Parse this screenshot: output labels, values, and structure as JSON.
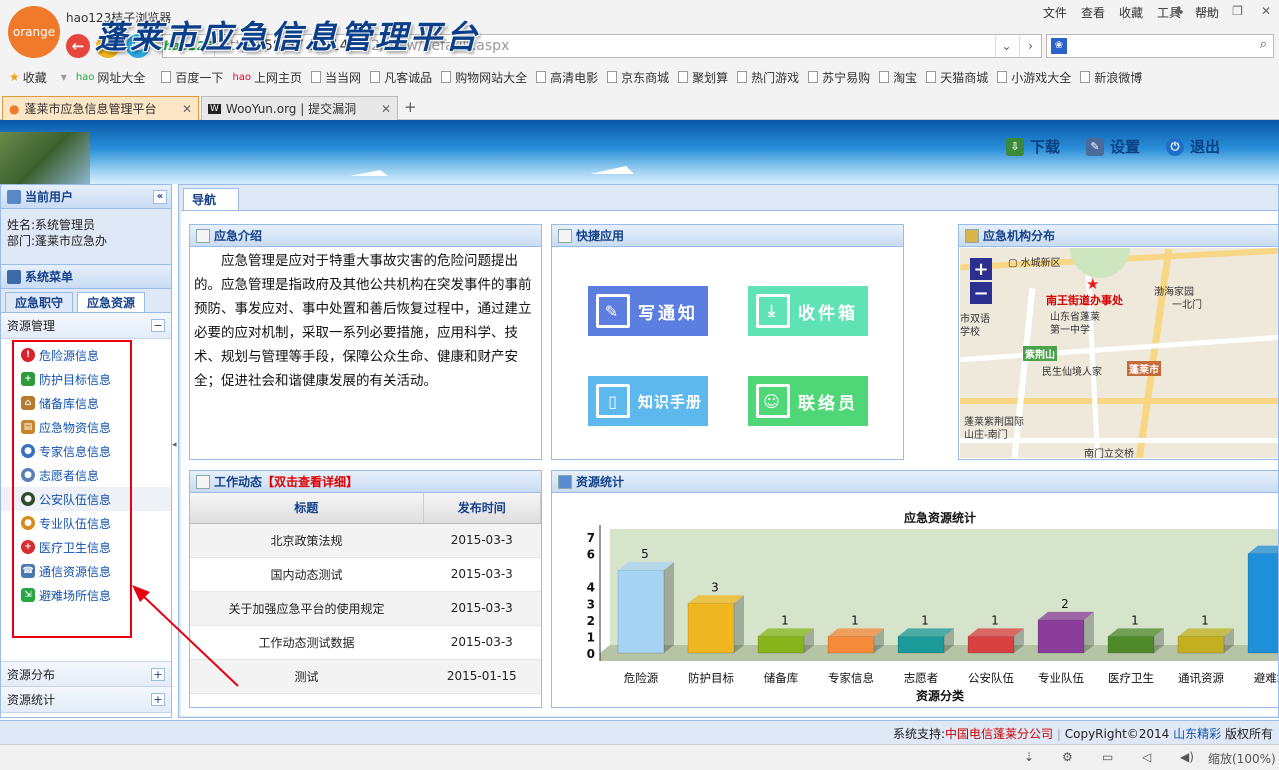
{
  "browser": {
    "logo_text": "orange",
    "app_title": "hao123桔子浏览器",
    "menu": [
      "文件",
      "查看",
      "收藏",
      "工具",
      "帮助"
    ],
    "url_brand": "hao123",
    "url_prefix": "http://",
    "url_host": "58.57.21.146",
    "url_rest": ":92/View/default.aspx",
    "bookmarks": [
      "收藏",
      "网址大全",
      "百度一下",
      "上网主页",
      "当当网",
      "凡客诚品",
      "购物网站大全",
      "高清电影",
      "京东商城",
      "聚划算",
      "热门游戏",
      "苏宁易购",
      "淘宝",
      "天猫商城",
      "小游戏大全",
      "新浪微博"
    ],
    "tabs": [
      {
        "label": "蓬莱市应急信息管理平台",
        "active": true
      },
      {
        "label": "WooYun.org | 提交漏洞",
        "active": false
      }
    ],
    "new_tab": "+",
    "zoom_label": "缩放(100%)"
  },
  "header": {
    "title": "蓬莱市应急信息管理平台",
    "download": "下载",
    "settings": "设置",
    "logout": "退出"
  },
  "left": {
    "user_title": "当前用户",
    "user_name": "姓名:系统管理员",
    "user_dept": "部门:蓬莱市应急办",
    "menu_title": "系统菜单",
    "subtabs": [
      "应急职守",
      "应急资源"
    ],
    "section_open": "资源管理",
    "resources": [
      {
        "label": "危险源信息",
        "color": "#d9202a"
      },
      {
        "label": "防护目标信息",
        "color": "#2e9b3a"
      },
      {
        "label": "储备库信息",
        "color": "#b77a2e"
      },
      {
        "label": "应急物资信息",
        "color": "#c8862a"
      },
      {
        "label": "专家信息信息",
        "color": "#3a6fc0"
      },
      {
        "label": "志愿者信息",
        "color": "#5a7fb6"
      },
      {
        "label": "公安队伍信息",
        "color": "#2f4d2b"
      },
      {
        "label": "专业队伍信息",
        "color": "#d78a1a"
      },
      {
        "label": "医疗卫生信息",
        "color": "#d92e2e"
      },
      {
        "label": "通信资源信息",
        "color": "#4a78b0"
      },
      {
        "label": "避难场所信息",
        "color": "#26a645"
      }
    ],
    "section_dist": "资源分布",
    "section_stat": "资源统计"
  },
  "main": {
    "tab": "导航",
    "intro": {
      "title": "应急介绍",
      "text": "应急管理是应对于特重大事故灾害的危险问题提出的。应急管理是指政府及其他公共机构在突发事件的事前预防、事发应对、事中处置和善后恢复过程中，通过建立必要的应对机制，采取一系列必要措施，应用科学、技术、规划与管理等手段，保障公众生命、健康和财产安全；促进社会和谐健康发展的有关活动。"
    },
    "quick": {
      "title": "快捷应用",
      "buttons": [
        {
          "label": "写通知",
          "color": "#5b7ee0",
          "icon": "✎"
        },
        {
          "label": "收件箱",
          "color": "#5fe3b5",
          "icon": "⤓"
        },
        {
          "label": "知识手册",
          "color": "#5db8ee",
          "icon": "▯"
        },
        {
          "label": "联络员",
          "color": "#4fd777",
          "icon": "☺"
        }
      ]
    },
    "map": {
      "title": "应急机构分布",
      "labels": [
        "水城新区",
        "渤海家园",
        "一北门",
        "南王街道办事处",
        "山东省蓬莱",
        "第一中学",
        "市双语",
        "学校",
        "紫荆山",
        "民生仙境人家",
        "蓬莱市",
        "蓬莱紫荆国际",
        "山庄-南门",
        "南门立交桥",
        "蓬莱"
      ]
    },
    "news": {
      "title": "工作动态",
      "hint": "【双击查看详细】",
      "col_title": "标题",
      "col_date": "发布时间",
      "rows": [
        {
          "title": "北京政策法规",
          "date": "2015-03-3"
        },
        {
          "title": "国内动态测试",
          "date": "2015-03-3"
        },
        {
          "title": "关于加强应急平台的使用规定",
          "date": "2015-03-3"
        },
        {
          "title": "工作动态测试数据",
          "date": "2015-03-3"
        },
        {
          "title": "测试",
          "date": "2015-01-15"
        }
      ]
    },
    "stats": {
      "title": "资源统计"
    }
  },
  "chart_data": {
    "type": "bar",
    "title": "应急资源统计",
    "xlabel": "资源分类",
    "ylabel": "",
    "ylim": [
      0,
      7
    ],
    "yticks": [
      0,
      1,
      2,
      3,
      4,
      6,
      7
    ],
    "categories": [
      "危险源",
      "防护目标",
      "储备库",
      "专家信息",
      "志愿者",
      "公安队伍",
      "专业队伍",
      "医疗卫生",
      "通讯资源",
      "避难场"
    ],
    "values": [
      5,
      3,
      1,
      1,
      1,
      1,
      2,
      1,
      1,
      6
    ],
    "show_value_labels": [
      true,
      true,
      true,
      true,
      true,
      true,
      true,
      true,
      true,
      false
    ],
    "colors": [
      "#a8d4f3",
      "#f0b820",
      "#86b41a",
      "#f48a3a",
      "#1c9a9a",
      "#d94040",
      "#8a3d9a",
      "#4f8a2a",
      "#c2b020",
      "#1e8fd8"
    ]
  },
  "footer": {
    "support_label": "系统支持:",
    "support_value": "中国电信蓬莱分公司",
    "copyright": "CopyRight©2014",
    "company": "山东精彩",
    "rights": "版权所有"
  }
}
